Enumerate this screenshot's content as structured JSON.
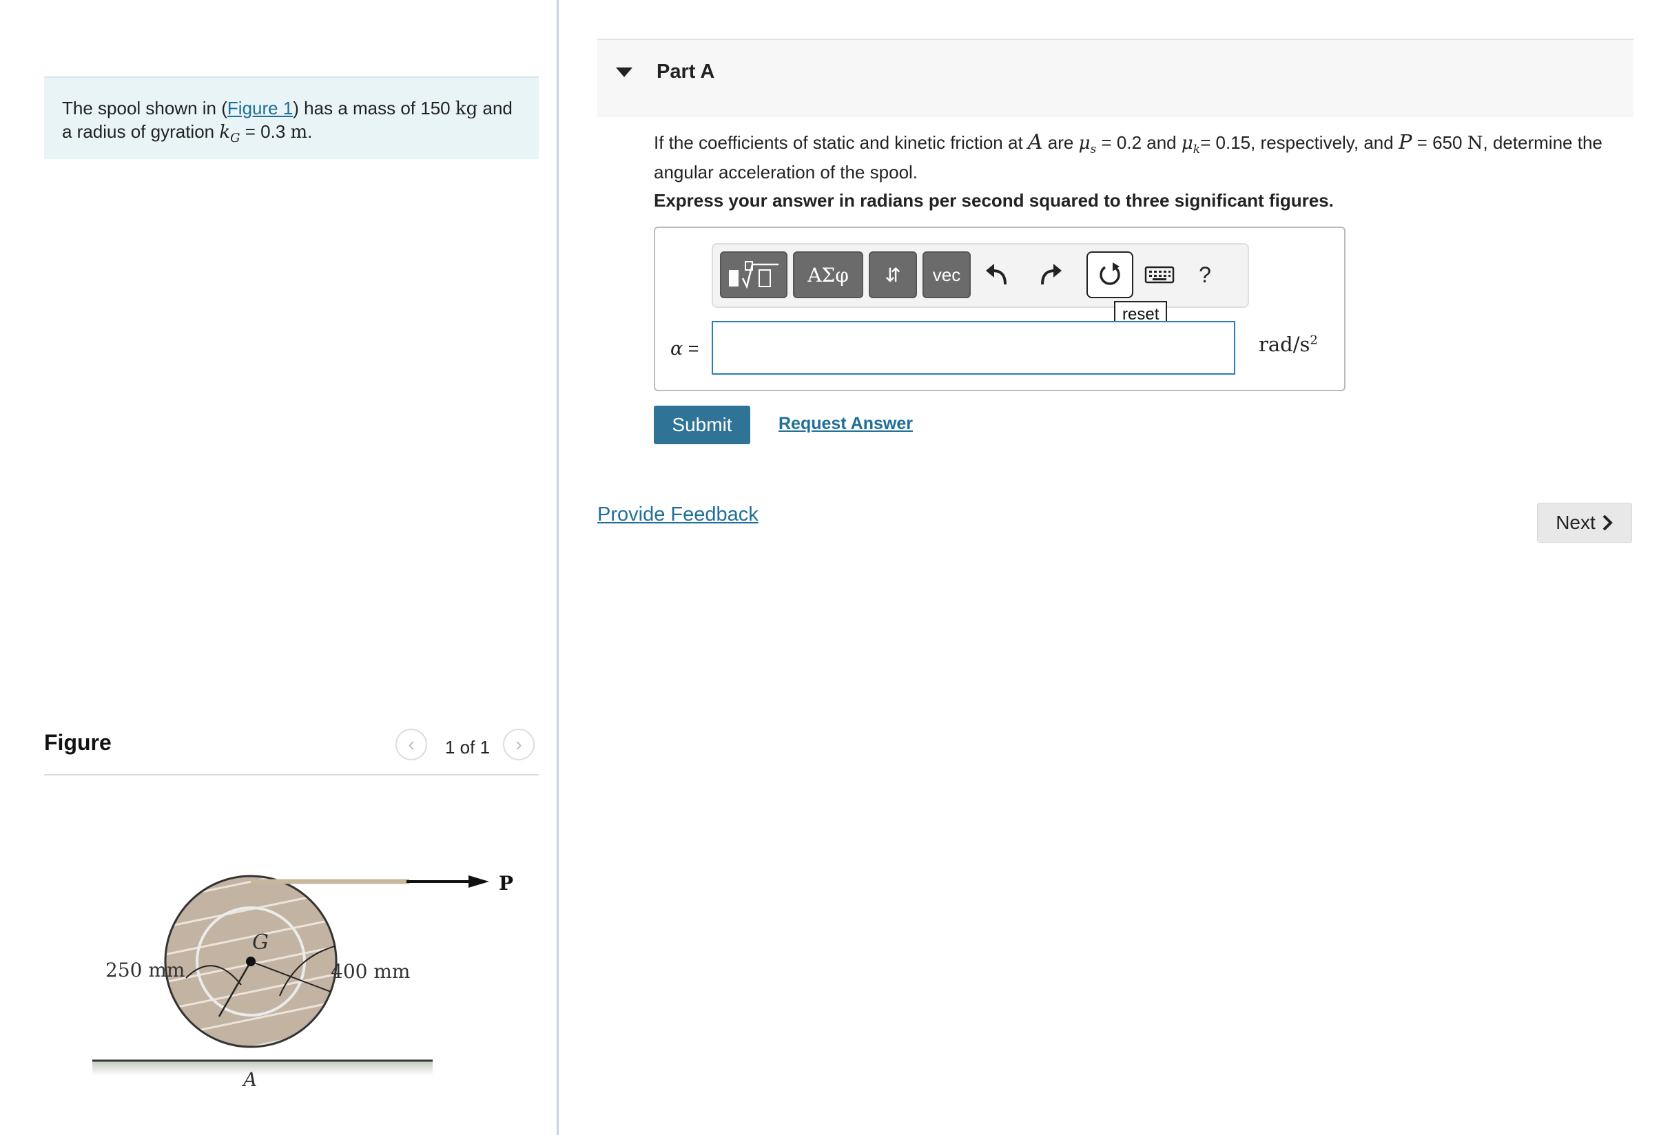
{
  "problem": {
    "text_before": "The spool shown in (",
    "figure_link": "Figure 1",
    "text_mid": ") has a mass of 150 ",
    "mass_unit": "kg",
    "text_after": " and a radius of gyration ",
    "k_symbol": "k",
    "k_sub": "G",
    "k_value": " = 0.3 ",
    "k_unit": "m",
    "period": "."
  },
  "figure_panel": {
    "title": "Figure",
    "pager_text": "1 of 1",
    "labels": {
      "left_dim": "250 mm",
      "right_dim": "400 mm",
      "center": "G",
      "contact": "A",
      "force": "P"
    }
  },
  "part": {
    "title": "Part A",
    "question": {
      "t1": "If the coefficients of static and kinetic friction at ",
      "A": "A",
      "t2": " are ",
      "mu": "μ",
      "s": "s",
      "t3": " = 0.2 and ",
      "k": "k",
      "t4": "= 0.15, respectively, and ",
      "P": "P",
      "t5": " = 650 ",
      "N": "N",
      "t6": ", determine the angular acceleration of the spool."
    },
    "instruction": "Express your answer in radians per second squared to three significant figures."
  },
  "toolbar": {
    "greek_label": "ΑΣφ",
    "arrows_label": "⇵",
    "vec_label": "vec",
    "help_label": "?",
    "reset_tooltip": "reset"
  },
  "answer": {
    "variable": "α",
    "equals": " =",
    "value": "",
    "units": "rad/s",
    "units_exp": "2"
  },
  "actions": {
    "submit": "Submit",
    "request": "Request Answer",
    "feedback": "Provide Feedback",
    "next": "Next"
  },
  "icons": [
    "templates-icon",
    "undo-icon",
    "redo-icon",
    "reset-icon",
    "keyboard-icon",
    "chevron-left-icon",
    "chevron-right-icon",
    "chevron-down-icon"
  ]
}
